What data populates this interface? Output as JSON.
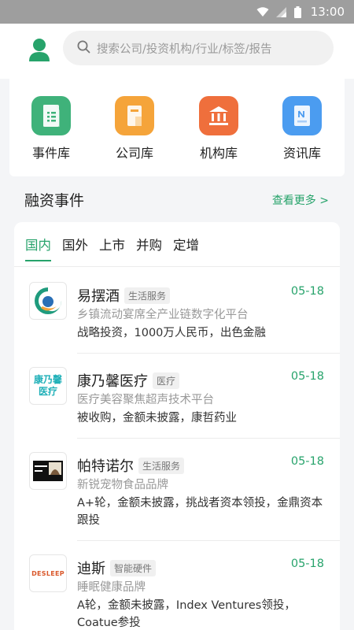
{
  "status_bar": {
    "time": "13:00"
  },
  "search": {
    "placeholder": "搜索公司/投资机构/行业/标签/报告"
  },
  "quick_links": [
    {
      "label": "事件库",
      "color": "#3fb27a",
      "icon": "document-list-icon"
    },
    {
      "label": "公司库",
      "color": "#f5a43a",
      "icon": "company-building-icon"
    },
    {
      "label": "机构库",
      "color": "#ef6f3c",
      "icon": "institution-bank-icon"
    },
    {
      "label": "资讯库",
      "color": "#4b9cf0",
      "icon": "news-document-icon"
    }
  ],
  "section": {
    "title": "融资事件",
    "more": "查看更多 >"
  },
  "tabs": [
    {
      "label": "国内",
      "active": true
    },
    {
      "label": "国外",
      "active": false
    },
    {
      "label": "上市",
      "active": false
    },
    {
      "label": "并购",
      "active": false
    },
    {
      "label": "定增",
      "active": false
    }
  ],
  "events": [
    {
      "name": "易摆酒",
      "tag": "生活服务",
      "date": "05-18",
      "desc": "乡镇流动宴席全产业链数字化平台",
      "deal": "战略投资，1000万人民币，出色金融"
    },
    {
      "name": "康乃馨医疗",
      "tag": "医疗",
      "date": "05-18",
      "desc": "医疗美容聚焦超声技术平台",
      "deal": "被收购，金额未披露，康哲药业",
      "logo_text": [
        "康乃馨",
        "医疗"
      ]
    },
    {
      "name": "帕特诺尔",
      "tag": "生活服务",
      "date": "05-18",
      "desc": "新锐宠物食品品牌",
      "deal": "A+轮，金额未披露，挑战者资本领投，金鼎资本跟投"
    },
    {
      "name": "迪斯",
      "tag": "智能硬件",
      "date": "05-18",
      "desc": "睡眠健康品牌",
      "deal": "A轮，金额未披露，Index Ventures领投，Coatue参投",
      "logo_text": [
        "DESLEEP"
      ]
    }
  ],
  "colors": {
    "accent": "#27a36b"
  }
}
